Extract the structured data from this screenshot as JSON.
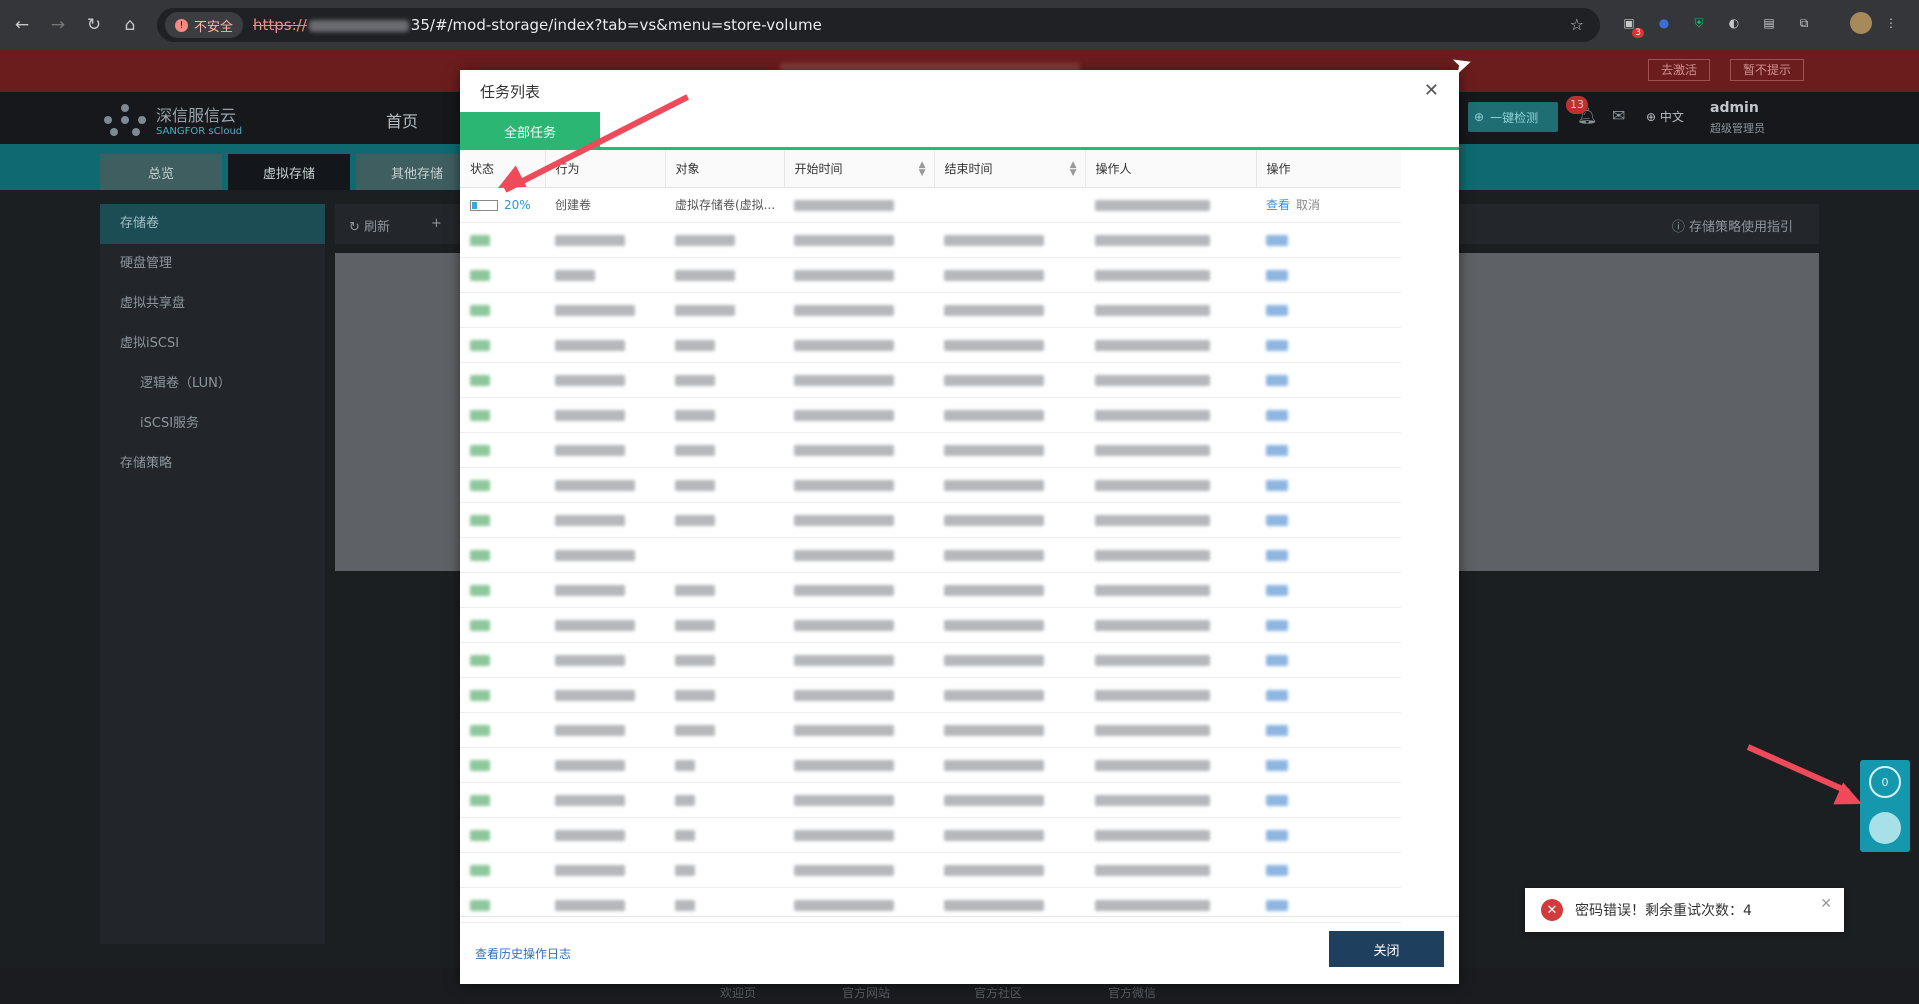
{
  "browser": {
    "insecure_label": "不安全",
    "url_proto": "https://",
    "url_suffix": "35/#/mod-storage/index?tab=vs&menu=store-volume",
    "ext_badge": "3"
  },
  "banner": {
    "activate": "去激活",
    "dismiss": "暂不提示"
  },
  "topnav": {
    "brand": "深信服信云",
    "brand_sub": "SANGFOR sCloud",
    "home": "首页",
    "check": "一键检测",
    "notif_count": "13",
    "lang": "中文",
    "user": "admin",
    "role": "超级管理员"
  },
  "tabs": [
    "总览",
    "虚拟存储",
    "其他存储"
  ],
  "sidebar": [
    "存储卷",
    "硬盘管理",
    "虚拟共享盘",
    "虚拟iSCSI",
    "逻辑卷（LUN）",
    "iSCSI服务",
    "存储策略"
  ],
  "toolbar": {
    "refresh": "刷新",
    "add": "+",
    "guide": "存储策略使用指引"
  },
  "modal": {
    "title": "任务列表",
    "tab_all": "全部任务",
    "columns": [
      "状态",
      "行为",
      "对象",
      "开始时间",
      "结束时间",
      "操作人",
      "操作"
    ],
    "first_row": {
      "progress": 20,
      "progress_label": "20%",
      "action": "创建卷",
      "object": "虚拟存储卷(虚拟...",
      "view": "查看",
      "cancel": "取消"
    },
    "history_link": "查看历史操作日志",
    "close_button": "关闭"
  },
  "footer": [
    "欢迎页",
    "官方网站",
    "官方社区",
    "官方微信"
  ],
  "float_panel": {
    "count": "0"
  },
  "toast": {
    "message": "密码错误！剩余重试次数：4"
  }
}
